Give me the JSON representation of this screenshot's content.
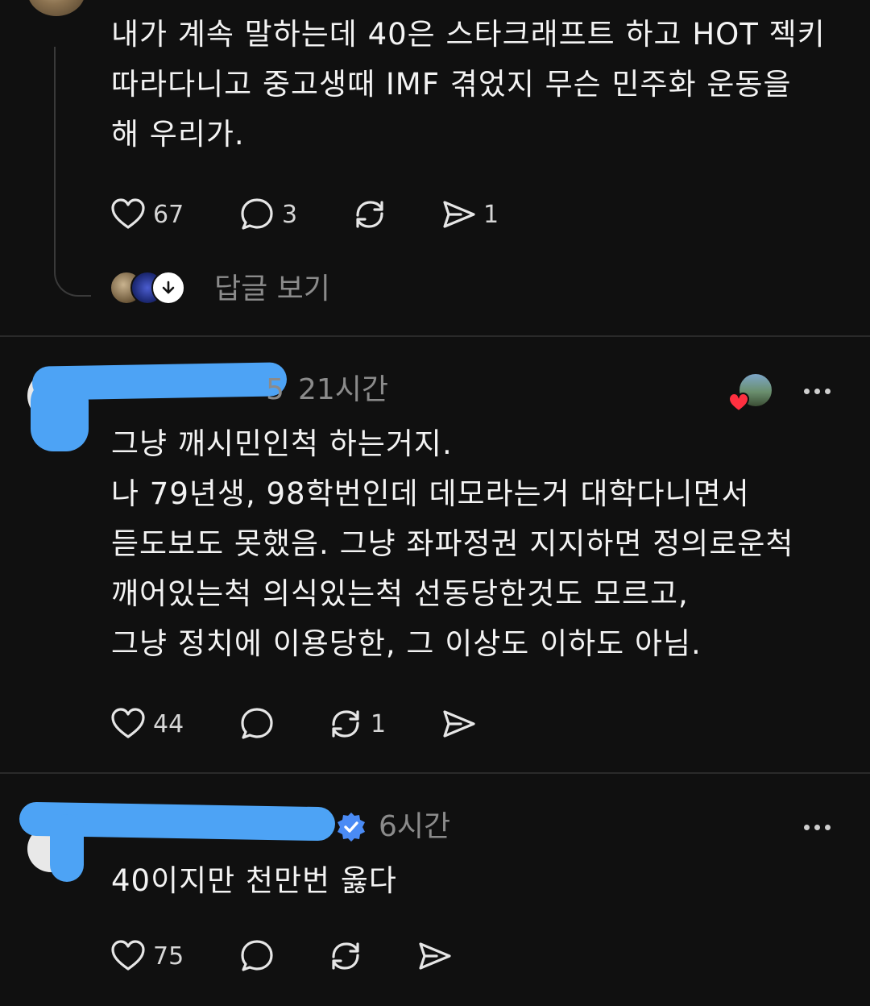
{
  "post1": {
    "text": "내가 계속 말하는데 40은 스타크래프트 하고 HOT 젝키\n따라다니고 중고생때 IMF 겪었지 무슨 민주화 운동을\n해 우리가.",
    "likes": "67",
    "comments": "3",
    "reposts": "",
    "shares": "1",
    "view_replies_label": "답글 보기"
  },
  "post2": {
    "username_suffix": "5",
    "time": "21시간",
    "text": "그냥 깨시민인척 하는거지.\n나 79년생, 98학번인데 데모라는거 대학다니면서\n듣도보도 못했음. 그냥 좌파정권 지지하면 정의로운척\n깨어있는척 의식있는척 선동당한것도 모르고,\n그냥 정치에 이용당한, 그 이상도 이하도 아님.",
    "likes": "44",
    "comments": "",
    "reposts": "1",
    "shares": ""
  },
  "post3": {
    "time": "6시간",
    "text": "40이지만 천만번 옳다",
    "likes": "75",
    "comments": "",
    "reposts": "",
    "shares": ""
  },
  "icons": {
    "like": "heart-icon",
    "comment": "comment-icon",
    "repost": "repost-icon",
    "share": "send-icon",
    "more": "more-icon",
    "verified": "verified-badge-icon"
  },
  "colors": {
    "background": "#101010",
    "text": "#f3f3f3",
    "muted": "#8b8b8b",
    "redaction": "#4da3f5",
    "verified": "#4a8bf5",
    "heart_badge": "#ff3040"
  }
}
